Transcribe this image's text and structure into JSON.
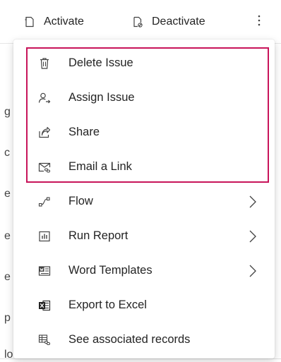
{
  "toolbar": {
    "activate_label": "Activate",
    "deactivate_label": "Deactivate"
  },
  "background_fragments": [
    "g",
    "c",
    "e",
    "e",
    "e",
    "p",
    "lo"
  ],
  "menu": {
    "items": [
      {
        "label": "Delete Issue",
        "icon": "trash-icon",
        "submenu": false
      },
      {
        "label": "Assign Issue",
        "icon": "assign-user-icon",
        "submenu": false
      },
      {
        "label": "Share",
        "icon": "share-icon",
        "submenu": false
      },
      {
        "label": "Email a Link",
        "icon": "email-link-icon",
        "submenu": false
      },
      {
        "label": "Flow",
        "icon": "flow-icon",
        "submenu": true
      },
      {
        "label": "Run Report",
        "icon": "report-icon",
        "submenu": true
      },
      {
        "label": "Word Templates",
        "icon": "word-template-icon",
        "submenu": true
      },
      {
        "label": "Export to Excel",
        "icon": "excel-icon",
        "submenu": false
      },
      {
        "label": "See associated records",
        "icon": "associated-records-icon",
        "submenu": false
      }
    ]
  },
  "colors": {
    "highlight_border": "#c8145a",
    "text": "#242424",
    "icon": "#424242",
    "excel_icon": "#222222"
  }
}
